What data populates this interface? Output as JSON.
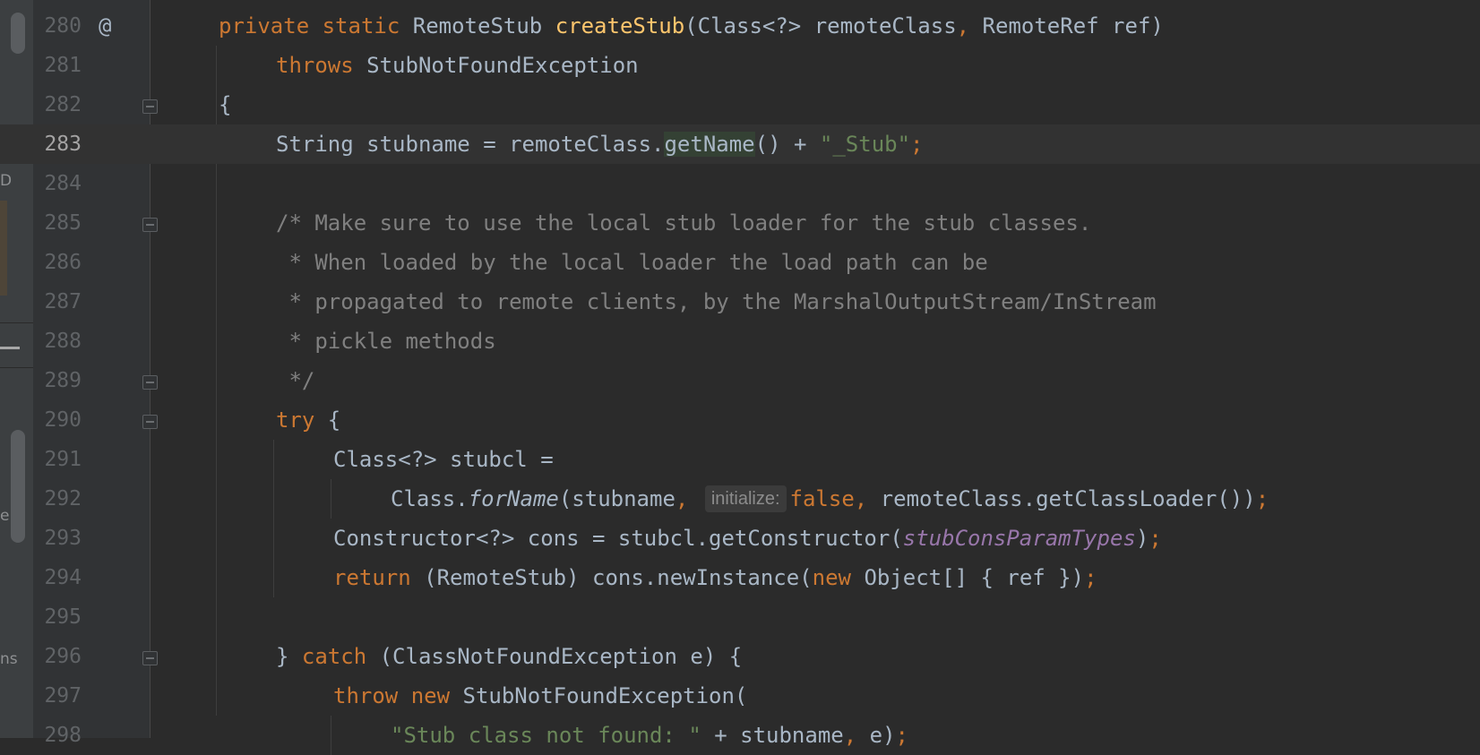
{
  "editor": {
    "current_line": "283",
    "lines": [
      {
        "n": "280",
        "marker": "@",
        "fold": false,
        "indent": 1,
        "tokens": [
          {
            "t": "private ",
            "c": "kw"
          },
          {
            "t": "static ",
            "c": "kw"
          },
          {
            "t": "RemoteStub ",
            "c": ""
          },
          {
            "t": "createStub",
            "c": "fn"
          },
          {
            "t": "(Class<?> remoteClass",
            "c": ""
          },
          {
            "t": ", ",
            "c": "kw"
          },
          {
            "t": "RemoteRef ref)",
            "c": ""
          }
        ]
      },
      {
        "n": "281",
        "fold": false,
        "indent": 2,
        "tokens": [
          {
            "t": "throws ",
            "c": "kw"
          },
          {
            "t": "StubNotFoundException",
            "c": ""
          }
        ]
      },
      {
        "n": "282",
        "fold": true,
        "indent": 1,
        "tokens": [
          {
            "t": "{",
            "c": ""
          }
        ]
      },
      {
        "n": "283",
        "fold": false,
        "indent": 2,
        "tokens": [
          {
            "t": "String stubname = remoteClass.",
            "c": ""
          },
          {
            "t": "getName",
            "c": "hl"
          },
          {
            "t": "() + ",
            "c": ""
          },
          {
            "t": "\"_Stub\"",
            "c": "str"
          },
          {
            "t": ";",
            "c": "kw"
          }
        ]
      },
      {
        "n": "284",
        "fold": false,
        "indent": 2,
        "tokens": []
      },
      {
        "n": "285",
        "fold": true,
        "indent": 2,
        "tokens": [
          {
            "t": "/* Make sure to use the local stub loader for the stub classes.",
            "c": "cmt"
          }
        ]
      },
      {
        "n": "286",
        "fold": false,
        "indent": 2,
        "tokens": [
          {
            "t": " * When loaded by the local loader the load path can be",
            "c": "cmt"
          }
        ]
      },
      {
        "n": "287",
        "fold": false,
        "indent": 2,
        "tokens": [
          {
            "t": " * propagated to remote clients, by the MarshalOutputStream/InStream",
            "c": "cmt"
          }
        ]
      },
      {
        "n": "288",
        "fold": false,
        "indent": 2,
        "tokens": [
          {
            "t": " * pickle methods",
            "c": "cmt"
          }
        ]
      },
      {
        "n": "289",
        "fold": true,
        "indent": 2,
        "tokens": [
          {
            "t": " */",
            "c": "cmt"
          }
        ]
      },
      {
        "n": "290",
        "fold": true,
        "indent": 2,
        "tokens": [
          {
            "t": "try ",
            "c": "kw"
          },
          {
            "t": "{",
            "c": ""
          }
        ]
      },
      {
        "n": "291",
        "fold": false,
        "indent": 3,
        "tokens": [
          {
            "t": "Class<?> stubcl =",
            "c": ""
          }
        ]
      },
      {
        "n": "292",
        "fold": false,
        "indent": 4,
        "tokens": [
          {
            "t": "Class.",
            "c": ""
          },
          {
            "t": "forName",
            "c": "it"
          },
          {
            "t": "(stubname",
            "c": ""
          },
          {
            "t": ", ",
            "c": "kw"
          },
          {
            "t": "initialize:",
            "c": "hint"
          },
          {
            "t": "false",
            "c": "kw"
          },
          {
            "t": ", ",
            "c": "kw"
          },
          {
            "t": "remoteClass.getClassLoader())",
            "c": ""
          },
          {
            "t": ";",
            "c": "kw"
          }
        ]
      },
      {
        "n": "293",
        "fold": false,
        "indent": 3,
        "tokens": [
          {
            "t": "Constructor<?> cons = stubcl.getConstructor(",
            "c": ""
          },
          {
            "t": "stubConsParamTypes",
            "c": "fld"
          },
          {
            "t": ")",
            "c": ""
          },
          {
            "t": ";",
            "c": "kw"
          }
        ]
      },
      {
        "n": "294",
        "fold": false,
        "indent": 3,
        "tokens": [
          {
            "t": "return ",
            "c": "kw"
          },
          {
            "t": "(RemoteStub) cons.newInstance(",
            "c": ""
          },
          {
            "t": "new ",
            "c": "kw"
          },
          {
            "t": "Object[] { ref })",
            "c": ""
          },
          {
            "t": ";",
            "c": "kw"
          }
        ]
      },
      {
        "n": "295",
        "fold": false,
        "indent": 3,
        "tokens": []
      },
      {
        "n": "296",
        "fold": true,
        "indent": 2,
        "tokens": [
          {
            "t": "} ",
            "c": ""
          },
          {
            "t": "catch ",
            "c": "kw"
          },
          {
            "t": "(ClassNotFoundException e) {",
            "c": ""
          }
        ]
      },
      {
        "n": "297",
        "fold": false,
        "indent": 3,
        "tokens": [
          {
            "t": "throw ",
            "c": "kw"
          },
          {
            "t": "new ",
            "c": "kw"
          },
          {
            "t": "StubNotFoundException(",
            "c": ""
          }
        ]
      },
      {
        "n": "298",
        "fold": false,
        "indent": 4,
        "tokens": [
          {
            "t": "\"Stub class not found: \"",
            "c": "str"
          },
          {
            "t": " + stubname",
            "c": ""
          },
          {
            "t": ", ",
            "c": "kw"
          },
          {
            "t": "e)",
            "c": ""
          },
          {
            "t": ";",
            "c": "kw"
          }
        ]
      }
    ]
  },
  "side_panel": {
    "glyphs": [
      "D",
      "e",
      "ns"
    ]
  }
}
